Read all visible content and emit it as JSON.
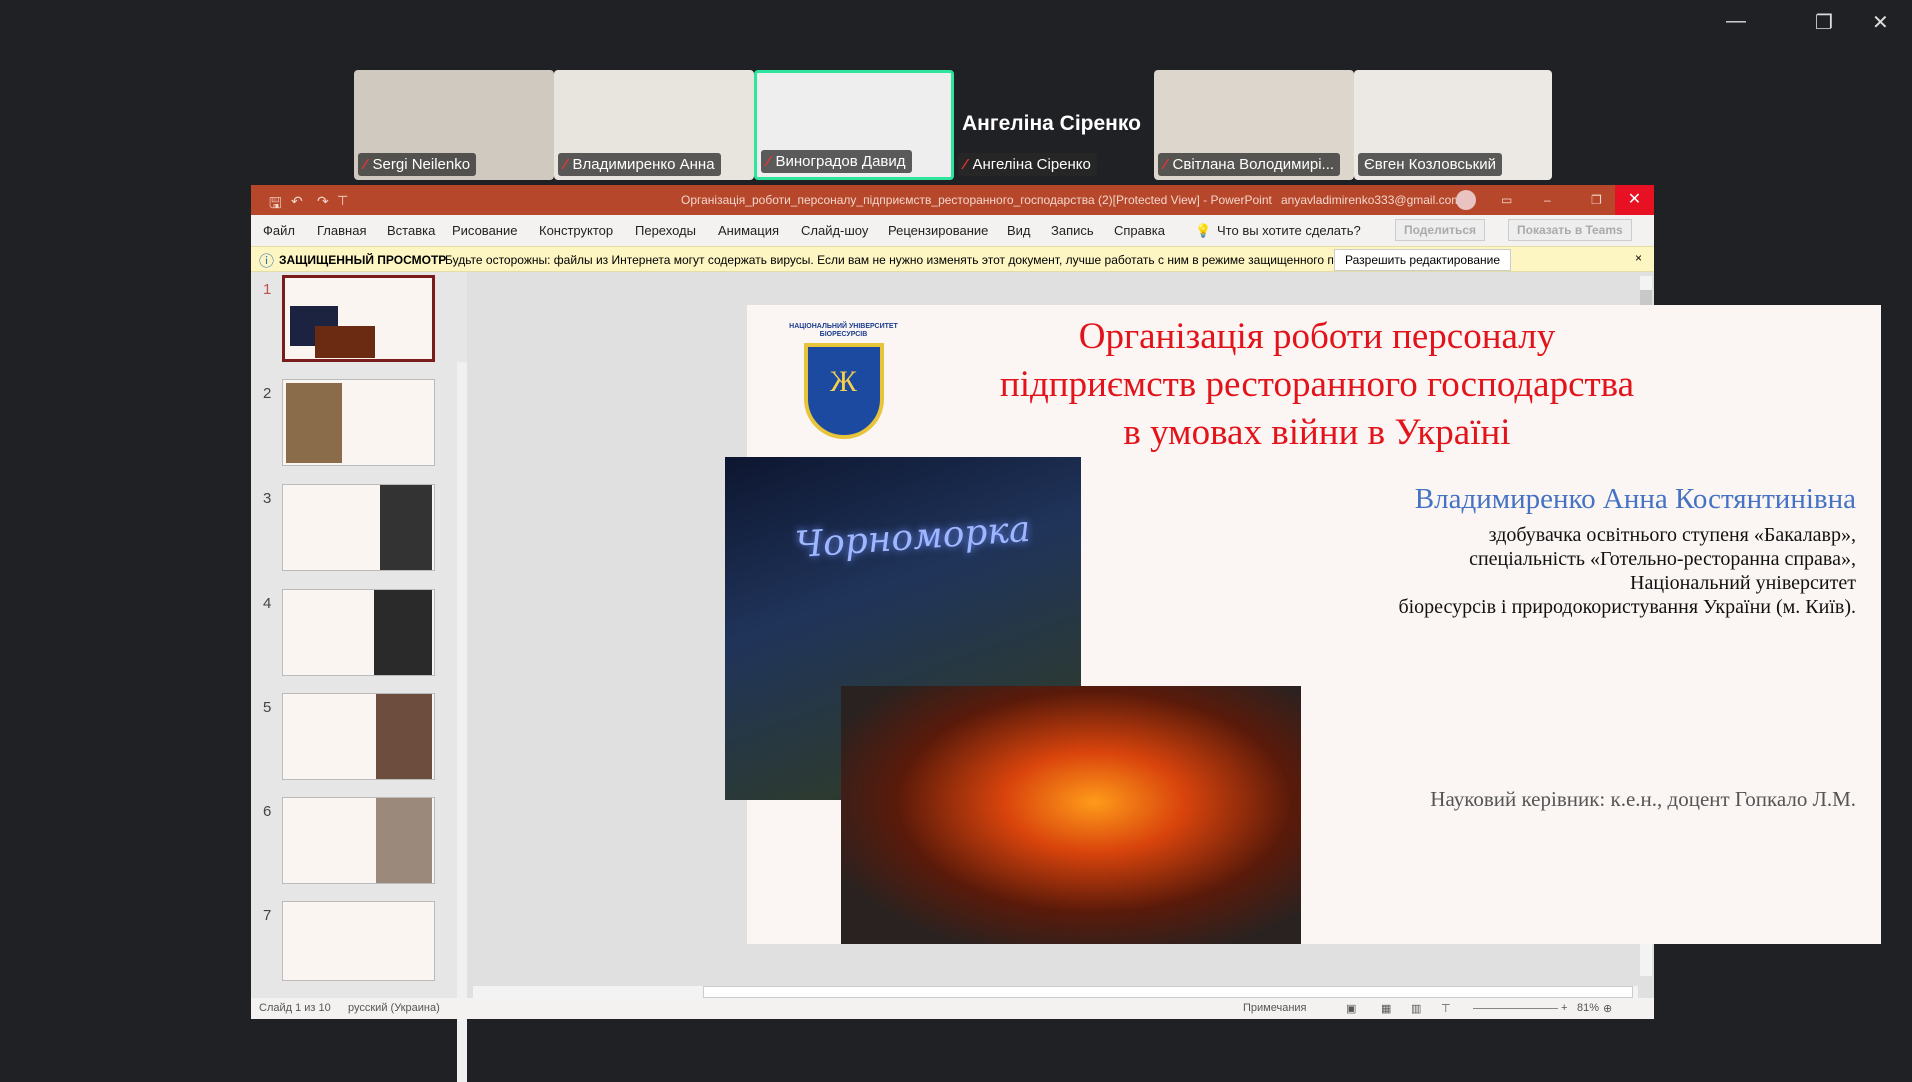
{
  "meeting": {
    "participants": [
      {
        "name": "Sergi Neilenko"
      },
      {
        "name": "Владимиренко Анна"
      },
      {
        "name": "Виноградов Давид"
      },
      {
        "name": "Ангеліна Сіренко"
      },
      {
        "name": "Світлана Володимирі..."
      },
      {
        "name": "Євген Козловський"
      }
    ],
    "featured_name": "Ангеліна Сіренко",
    "active_color": "#2ee59d"
  },
  "ppt": {
    "title": "Організація_роботи_персоналу_підприємств_ресторанного_господарства (2)[Protected View]  -  PowerPoint",
    "account": "anyavladimirenko333@gmail.com",
    "menu": [
      "Файл",
      "Главная",
      "Вставка",
      "Рисование",
      "Конструктор",
      "Переходы",
      "Анимация",
      "Слайд-шоу",
      "Рецензирование",
      "Вид",
      "Запись",
      "Справка"
    ],
    "search": "Что вы хотите сделать?",
    "share": "Поделиться",
    "teams": "Показать в Teams",
    "protected": {
      "label": "ЗАЩИЩЕННЫЙ ПРОСМОТР",
      "message": "Будьте осторожны: файлы из Интернета могут содержать вирусы. Если вам не нужно изменять этот документ, лучше работать с ним в режиме защищенного просмотра.",
      "button": "Разрешить редактирование",
      "close": "×"
    },
    "thumbnails": [
      "1",
      "2",
      "3",
      "4",
      "5",
      "6",
      "7"
    ],
    "status": {
      "slide": "Слайд 1 из 10",
      "lang": "русский (Украина)",
      "notes": "Примечания",
      "zoom": "81%"
    },
    "accent": "#b7472a"
  },
  "slide": {
    "title": [
      "Організація роботи персоналу",
      "підприємств ресторанного господарства",
      "в умовах війни в Україні"
    ],
    "author": "Владимиренко Анна Костянтинівна",
    "details": [
      "здобувачка освітнього ступеня «Бакалавр»,",
      "спеціальність «Готельно-ресторанна справа»,",
      "Національний університет",
      "біоресурсів і природокористування України (м. Київ)."
    ],
    "supervisor": "Науковий керівник: к.е.н., доцент Гопкало Л.М.",
    "logo_text": "НУБіП",
    "sign_text": "Чорноморка",
    "title_color": "#e3131b",
    "author_color": "#4472c4"
  }
}
